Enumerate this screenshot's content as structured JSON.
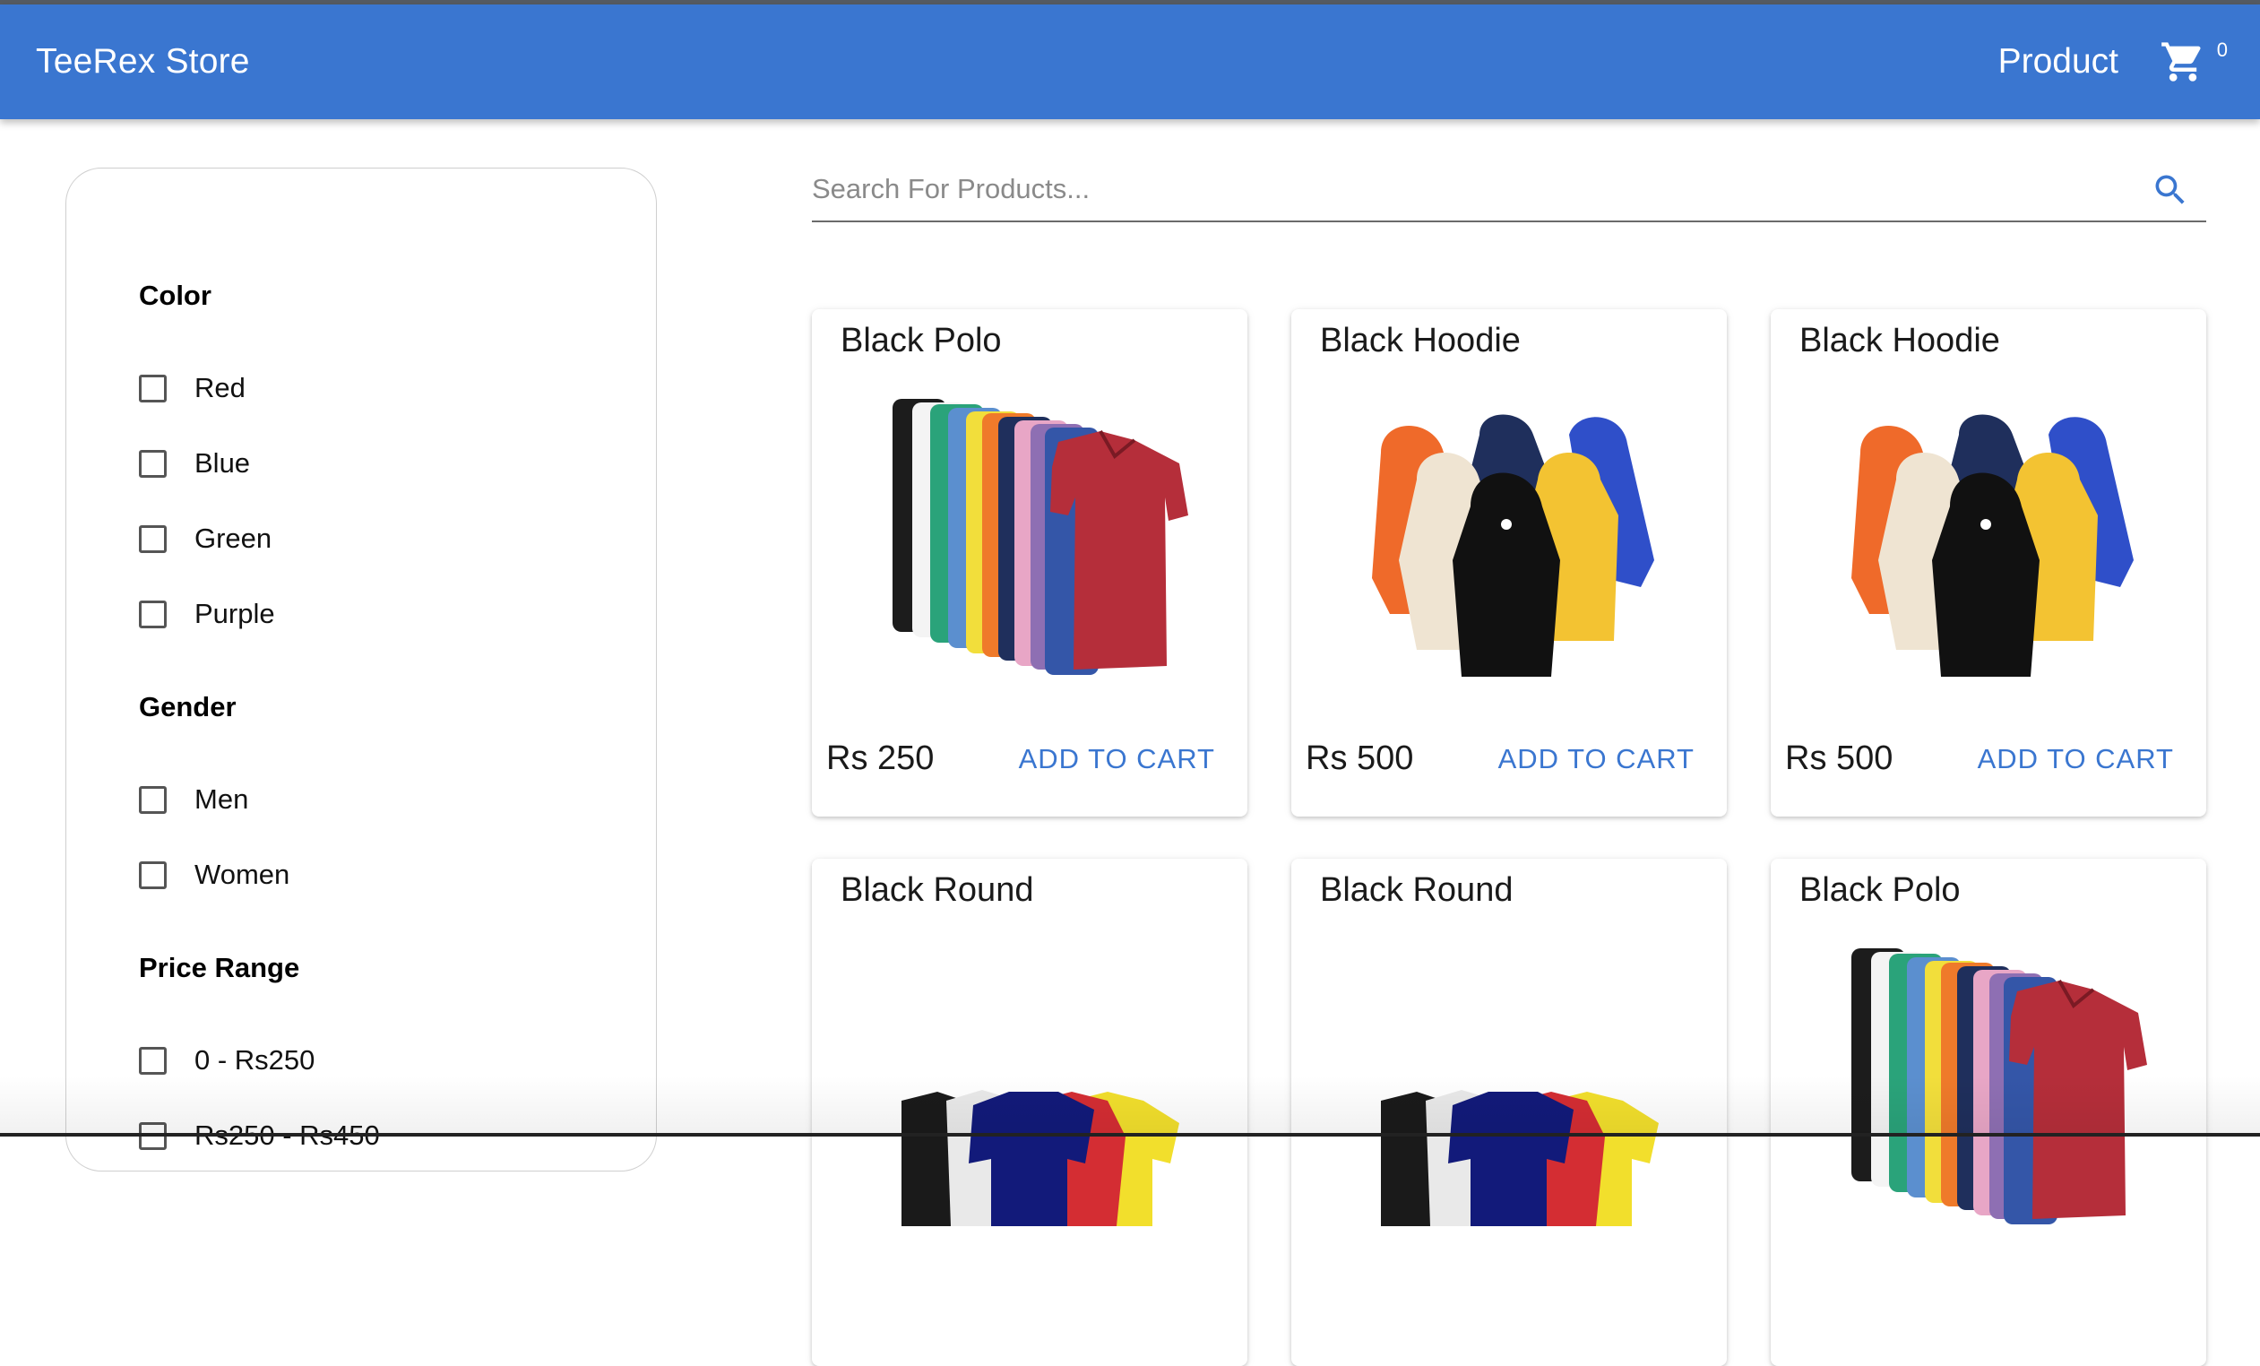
{
  "header": {
    "brand": "TeeRex Store",
    "nav_product": "Product",
    "cart_icon": "shopping-cart-icon",
    "cart_count": "0",
    "bg_color": "#3a76d0"
  },
  "search": {
    "placeholder": "Search For Products...",
    "value": "",
    "icon": "search-icon"
  },
  "filters": {
    "color": {
      "heading": "Color",
      "options": [
        "Red",
        "Blue",
        "Green",
        "Purple"
      ]
    },
    "gender": {
      "heading": "Gender",
      "options": [
        "Men",
        "Women"
      ]
    },
    "price": {
      "heading": "Price Range",
      "options": [
        "0 - Rs250",
        "Rs250 - Rs450"
      ]
    }
  },
  "products": [
    {
      "name": "Black Polo",
      "price": "Rs 250",
      "action": "ADD TO CART",
      "image": "polo-shirts-image"
    },
    {
      "name": "Black Hoodie",
      "price": "Rs 500",
      "action": "ADD TO CART",
      "image": "hoodies-image"
    },
    {
      "name": "Black Hoodie",
      "price": "Rs 500",
      "action": "ADD TO CART",
      "image": "hoodies-image"
    },
    {
      "name": "Black Round",
      "price": "",
      "action": "",
      "image": "round-tshirts-image"
    },
    {
      "name": "Black Round",
      "price": "",
      "action": "",
      "image": "round-tshirts-image"
    },
    {
      "name": "Black Polo",
      "price": "",
      "action": "",
      "image": "polo-shirts-image"
    }
  ]
}
